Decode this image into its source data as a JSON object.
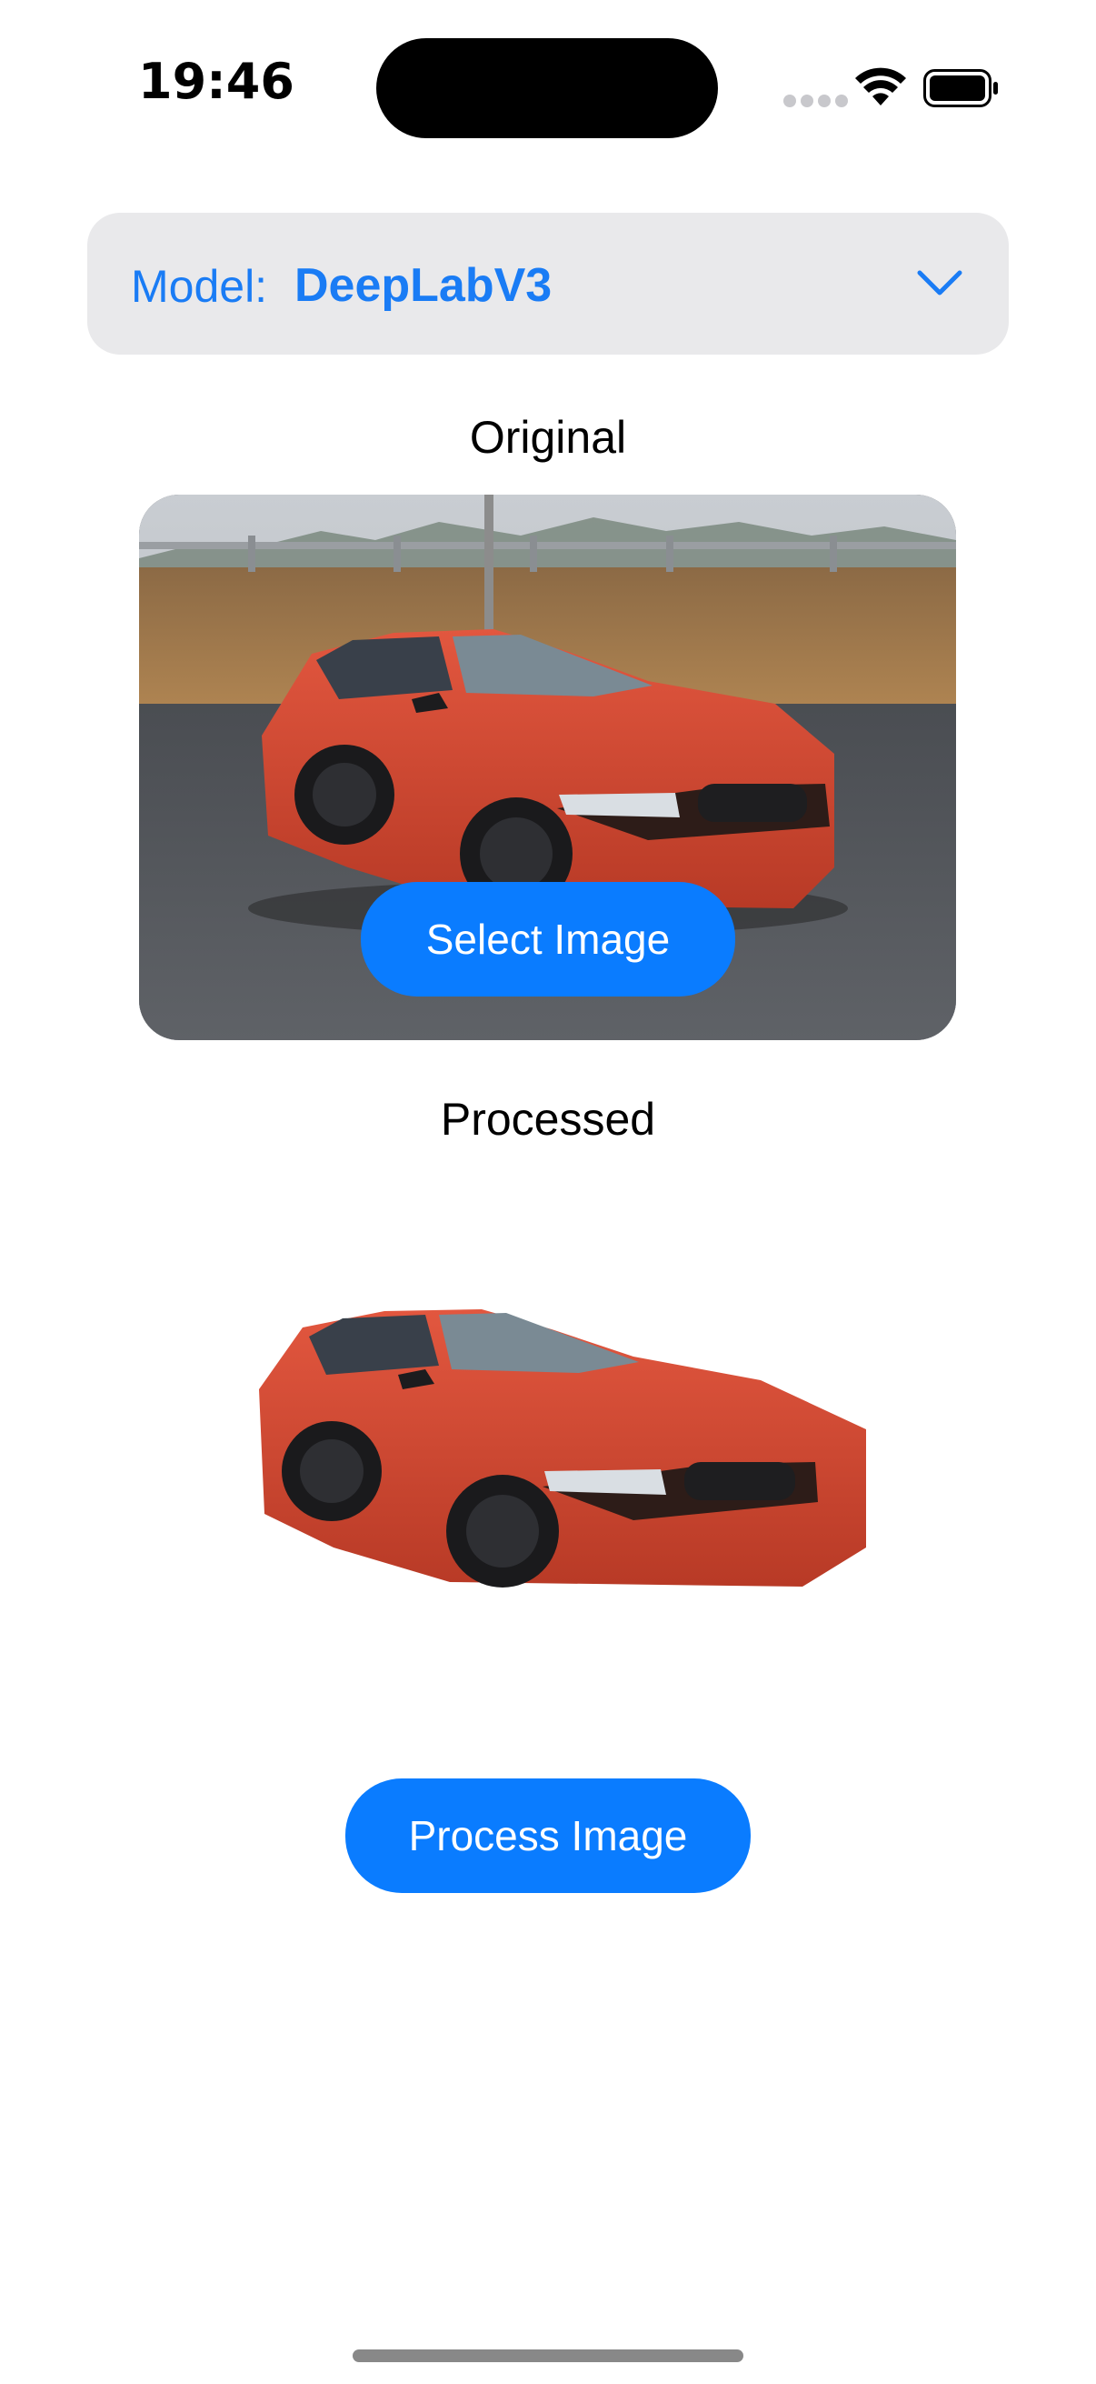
{
  "status_bar": {
    "time": "19:46",
    "icons": [
      "cellular-dots-icon",
      "wifi-icon",
      "battery-icon"
    ]
  },
  "model_picker": {
    "label": "Model:",
    "value": "DeepLabV3",
    "icon": "chevron-down-icon"
  },
  "original": {
    "title": "Original",
    "select_button": "Select Image"
  },
  "processed": {
    "title": "Processed"
  },
  "process_button": "Process Image",
  "colors": {
    "accent": "#0a7cff",
    "picker_bg": "#e9e9eb",
    "car_body": "#d8432f"
  }
}
